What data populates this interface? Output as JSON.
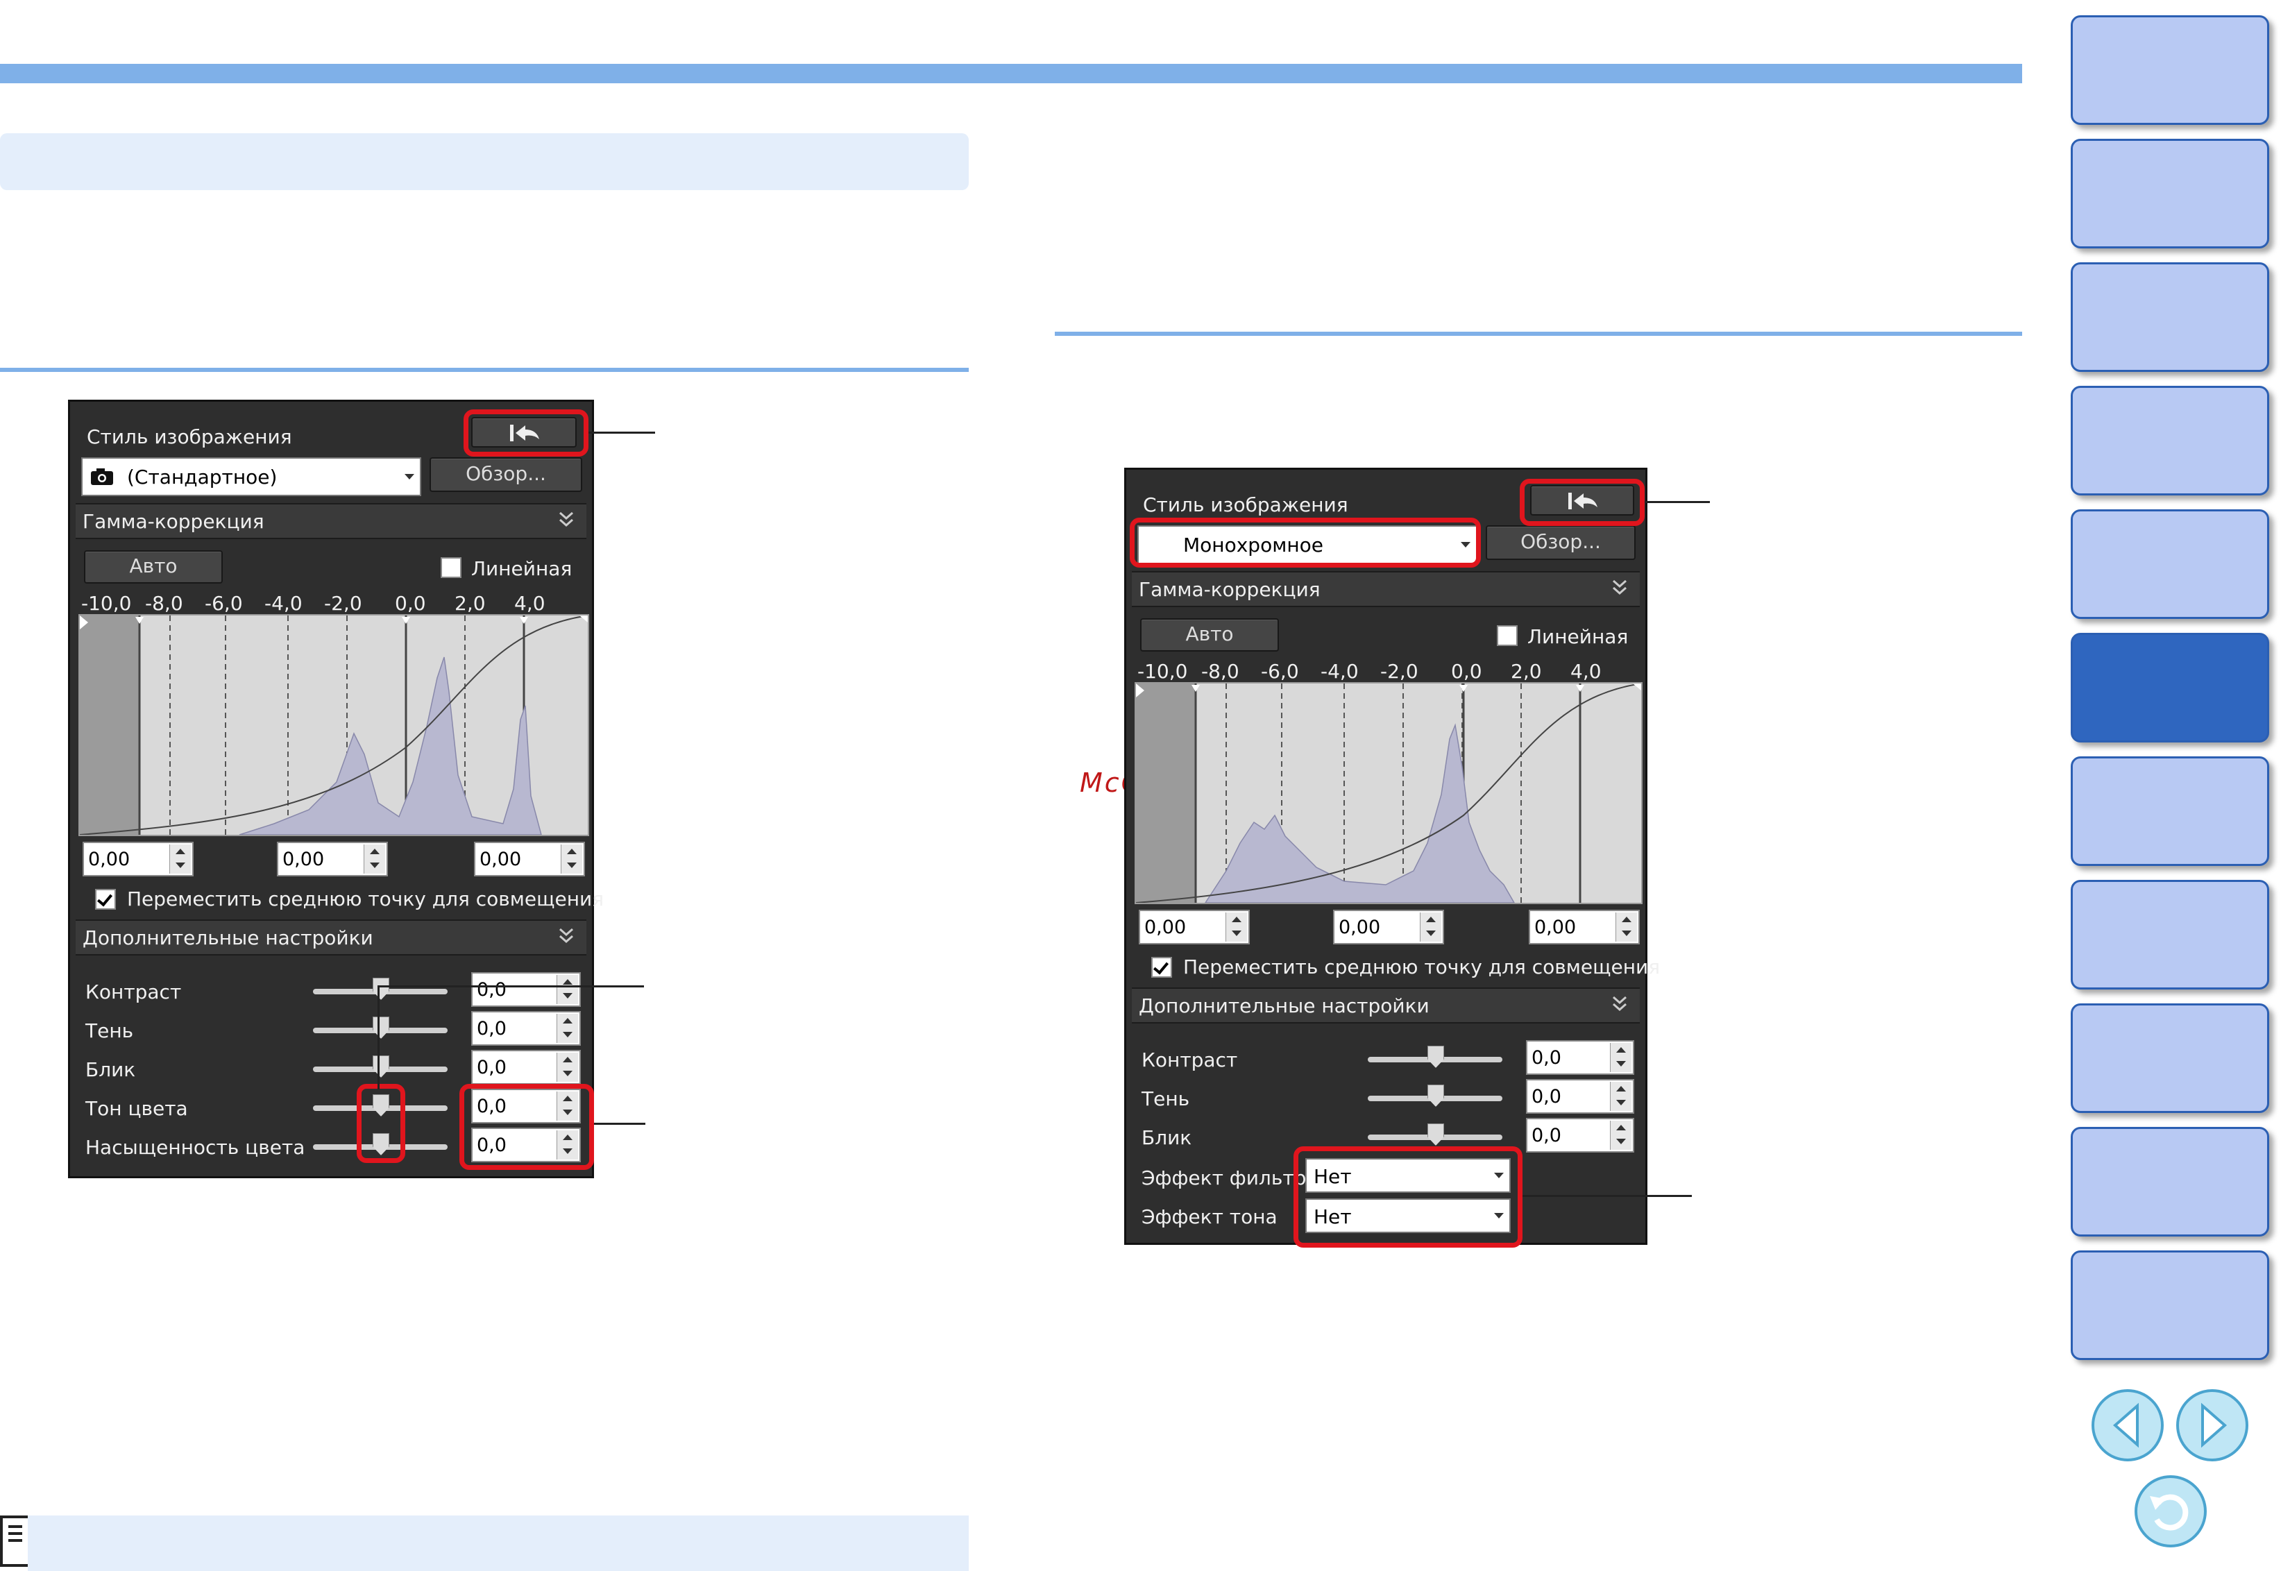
{
  "watermark": "McGrp.Ru",
  "panel_left": {
    "style_label": "Стиль изображения",
    "style_value": "(Стандартное)",
    "browse_label": "Обзор...",
    "gamma_label": "Гамма-коррекция",
    "auto_label": "Авто",
    "linear_label": "Линейная",
    "axis_ticks": [
      "-10,0",
      "-8,0",
      "-6,0",
      "-4,0",
      "-2,0",
      "0,0",
      "2,0",
      "4,0"
    ],
    "points": [
      "0,00",
      "0,00",
      "0,00"
    ],
    "move_mid_label": "Переместить среднюю точку для совмещения",
    "advanced_label": "Дополнительные настройки",
    "settings": [
      {
        "label": "Контраст",
        "value": "0,0"
      },
      {
        "label": "Тень",
        "value": "0,0"
      },
      {
        "label": "Блик",
        "value": "0,0"
      },
      {
        "label": "Тон цвета",
        "value": "0,0"
      },
      {
        "label": "Насыщенность цвета",
        "value": "0,0"
      }
    ]
  },
  "panel_right": {
    "style_label": "Стиль изображения",
    "style_value": "Монохромное",
    "browse_label": "Обзор...",
    "gamma_label": "Гамма-коррекция",
    "auto_label": "Авто",
    "linear_label": "Линейная",
    "axis_ticks": [
      "-10,0",
      "-8,0",
      "-6,0",
      "-4,0",
      "-2,0",
      "0,0",
      "2,0",
      "4,0"
    ],
    "points": [
      "0,00",
      "0,00",
      "0,00"
    ],
    "move_mid_label": "Переместить среднюю точку для совмещения",
    "advanced_label": "Дополнительные настройки",
    "settings": [
      {
        "label": "Контраст",
        "value": "0,0"
      },
      {
        "label": "Тень",
        "value": "0,0"
      },
      {
        "label": "Блик",
        "value": "0,0"
      }
    ],
    "filter_label": "Эффект фильтра",
    "filter_value": "Нет",
    "tone_label": "Эффект тона",
    "tone_value": "Нет"
  },
  "sidebar": {
    "tab_count": 11,
    "active_tab": 6
  },
  "colors": {
    "accent": "#7fb0e8",
    "tab": "#b8c9f3",
    "tab_active": "#2f66bf",
    "highlight": "#e0151d"
  }
}
